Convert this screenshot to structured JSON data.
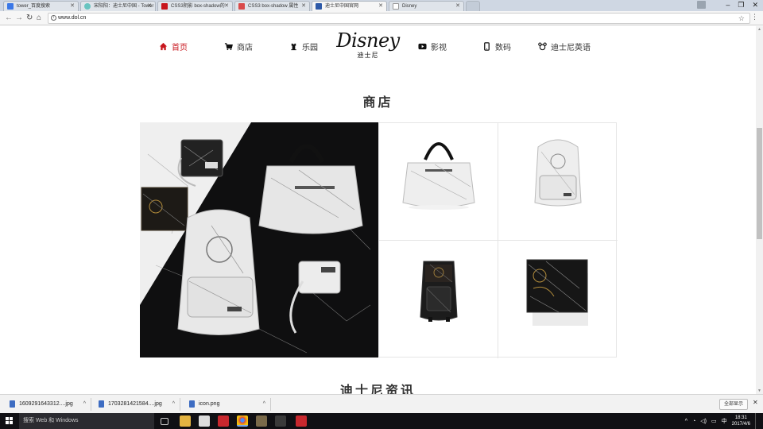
{
  "browser": {
    "tabs": [
      {
        "title": "tower_百度搜索",
        "favicon_color": "#3b78e7",
        "active": false
      },
      {
        "title": "宋阳阳：迪士尼中国 - Tower",
        "favicon_color": "#68c4c0",
        "active": false
      },
      {
        "title": "CSS3阴影 box-shadow的",
        "favicon_color": "#c8161d",
        "active": false
      },
      {
        "title": "CSS3 box-shadow 属性",
        "favicon_color": "#d94a4a",
        "active": false
      },
      {
        "title": "迪士尼中国官网",
        "favicon_color": "#2e5aa8",
        "active": true
      },
      {
        "title": "Disney",
        "favicon_color": "#cfcfcf",
        "active": false
      }
    ],
    "url": "www.dol.cn",
    "window_controls": [
      "–",
      "❐",
      "✕"
    ]
  },
  "site": {
    "nav": [
      {
        "label": "首页",
        "icon": "home-icon",
        "active": true
      },
      {
        "label": "商店",
        "icon": "cart-icon",
        "active": false
      },
      {
        "label": "乐园",
        "icon": "castle-icon",
        "active": false
      },
      {
        "label": "影视",
        "icon": "play-icon",
        "active": false
      },
      {
        "label": "数码",
        "icon": "phone-icon",
        "active": false
      },
      {
        "label": "迪士尼英语",
        "icon": "mickey-icon",
        "active": false
      }
    ],
    "logo": {
      "word": "Disney",
      "cn": "迪士尼"
    },
    "store_title": "商店",
    "news_title": "迪士尼资讯",
    "products": [
      {
        "name": "white-marble-tote-bag"
      },
      {
        "name": "white-marble-backpack"
      },
      {
        "name": "black-marble-backpack"
      },
      {
        "name": "black-gold-wallet"
      }
    ]
  },
  "downloads": {
    "items": [
      "1609291643312....jpg",
      "1703281421584....jpg",
      "icon.png"
    ],
    "show_all": "全部显示"
  },
  "taskbar": {
    "search_placeholder": "搜索 Web 和 Windows",
    "ime": "中",
    "time": "18:31",
    "date": "2017/4/6"
  }
}
